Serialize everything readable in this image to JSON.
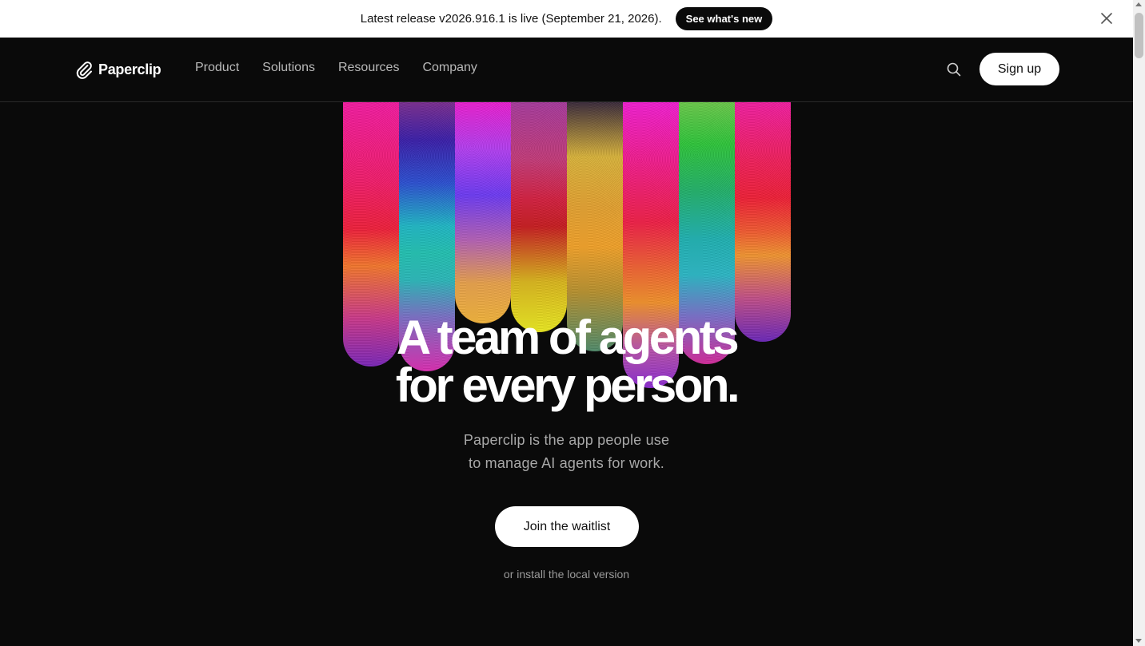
{
  "banner": {
    "text": "Latest release v2026.916.1 is live (September 21, 2026).",
    "button_label": "See what's new",
    "close_icon": "close-icon"
  },
  "nav": {
    "brand": "Paperclip",
    "logo_icon": "paperclip-icon",
    "links": [
      "Product",
      "Solutions",
      "Resources",
      "Company"
    ],
    "search_icon": "search-icon",
    "signup_label": "Sign up"
  },
  "hero": {
    "title_line1": "A team of agents",
    "title_line2": "for every person.",
    "subtitle_line1": "Paperclip is the app people use",
    "subtitle_line2": "to manage AI agents for work.",
    "cta_label": "Join the waitlist",
    "secondary_link": "or install the local version"
  },
  "colors": {
    "background": "#0a0a0a",
    "banner_bg": "#ffffff",
    "primary_button_bg": "#ffffff",
    "nav_link": "#b8b8b8",
    "subtitle": "#a8a8a8"
  }
}
